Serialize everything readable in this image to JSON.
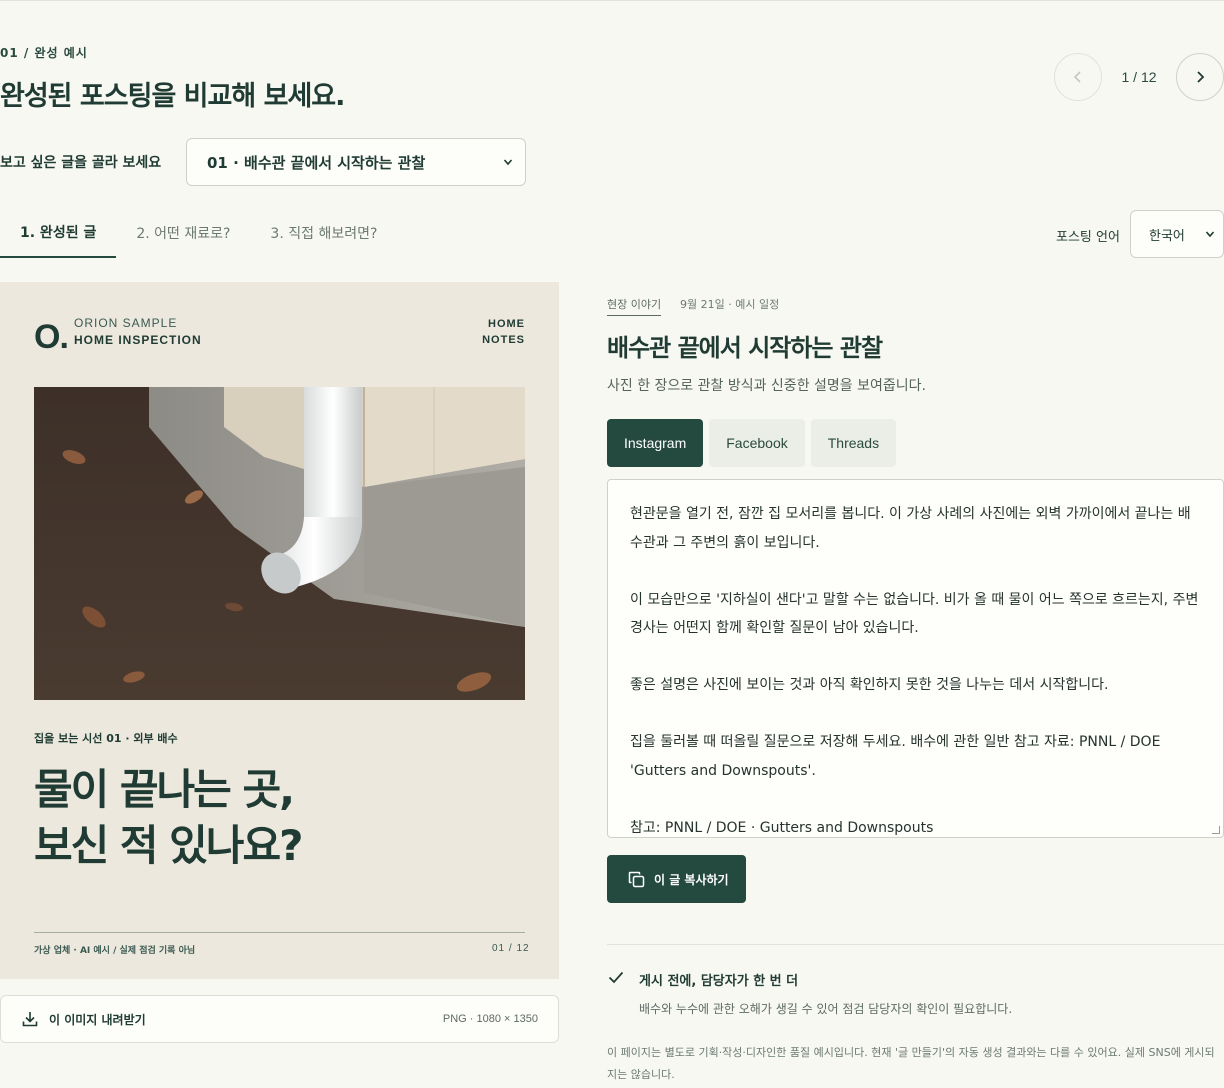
{
  "header": {
    "eyebrow": "01 / 완성 예시",
    "title": "완성된 포스팅을 비교해 보세요.",
    "pager": "1 / 12"
  },
  "selector": {
    "label": "보고 싶은 글을 골라 보세요",
    "value": "01 · 배수관 끝에서 시작하는 관찰"
  },
  "tabs": [
    "1. 완성된 글",
    "2. 어떤 재료로?",
    "3. 직접 해보려면?"
  ],
  "language": {
    "label": "포스팅 언어",
    "value": "한국어"
  },
  "card": {
    "logo": "O.",
    "brand_line1": "ORION SAMPLE",
    "brand_line2": "HOME INSPECTION",
    "nav_line1": "HOME",
    "nav_line2": "NOTES",
    "series": "집을 보는 시선 01 · 외부 배수",
    "headline_line1": "물이 끝나는 곳,",
    "headline_line2": "보신 적 있나요?",
    "footer_left": "가상 업체 · AI 예시 / 실제 점검 기록 아님",
    "footer_right": "01 / 12"
  },
  "download": {
    "label": "이 이미지 내려받기",
    "meta": "PNG · 1080 × 1350"
  },
  "post": {
    "category": "현장 이야기",
    "date": "9월 21일 · 예시 일정",
    "title": "배수관 끝에서 시작하는 관찰",
    "subtitle": "사진 한 장으로 관찰 방식과 신중한 설명을 보여줍니다.",
    "platforms": [
      "Instagram",
      "Facebook",
      "Threads"
    ],
    "body": [
      "현관문을 열기 전, 잠깐 집 모서리를 봅니다. 이 가상 사례의 사진에는 외벽 가까이에서 끝나는 배수관과 그 주변의 흙이 보입니다.",
      "이 모습만으로 '지하실이 샌다'고 말할 수는 없습니다. 비가 올 때 물이 어느 쪽으로 흐르는지, 주변 경사는 어떤지 함께 확인할 질문이 남아 있습니다.",
      "좋은 설명은 사진에 보이는 것과 아직 확인하지 못한 것을 나누는 데서 시작합니다.",
      "집을 둘러볼 때 떠올릴 질문으로 저장해 두세요. 배수에 관한 일반 참고 자료: PNNL / DOE 'Gutters and Downspouts'.",
      "참고: PNNL / DOE · Gutters and Downspouts"
    ],
    "copy_label": "이 글 복사하기"
  },
  "check": {
    "title": "게시 전에, 담당자가 한 번 더",
    "desc": "배수와 누수에 관한 오해가 생길 수 있어 점검 담당자의 확인이 필요합니다."
  },
  "disclaimer": "이 페이지는 별도로 기획·작성·디자인한 품질 예시입니다. 현재 '글 만들기'의 자동 생성 결과와는 다를 수 있어요. 실제 SNS에 게시되지는 않습니다.",
  "colors": {
    "brand": "#244a3f",
    "card_bg": "#ece8dd",
    "page_bg": "#f8f8f3"
  }
}
